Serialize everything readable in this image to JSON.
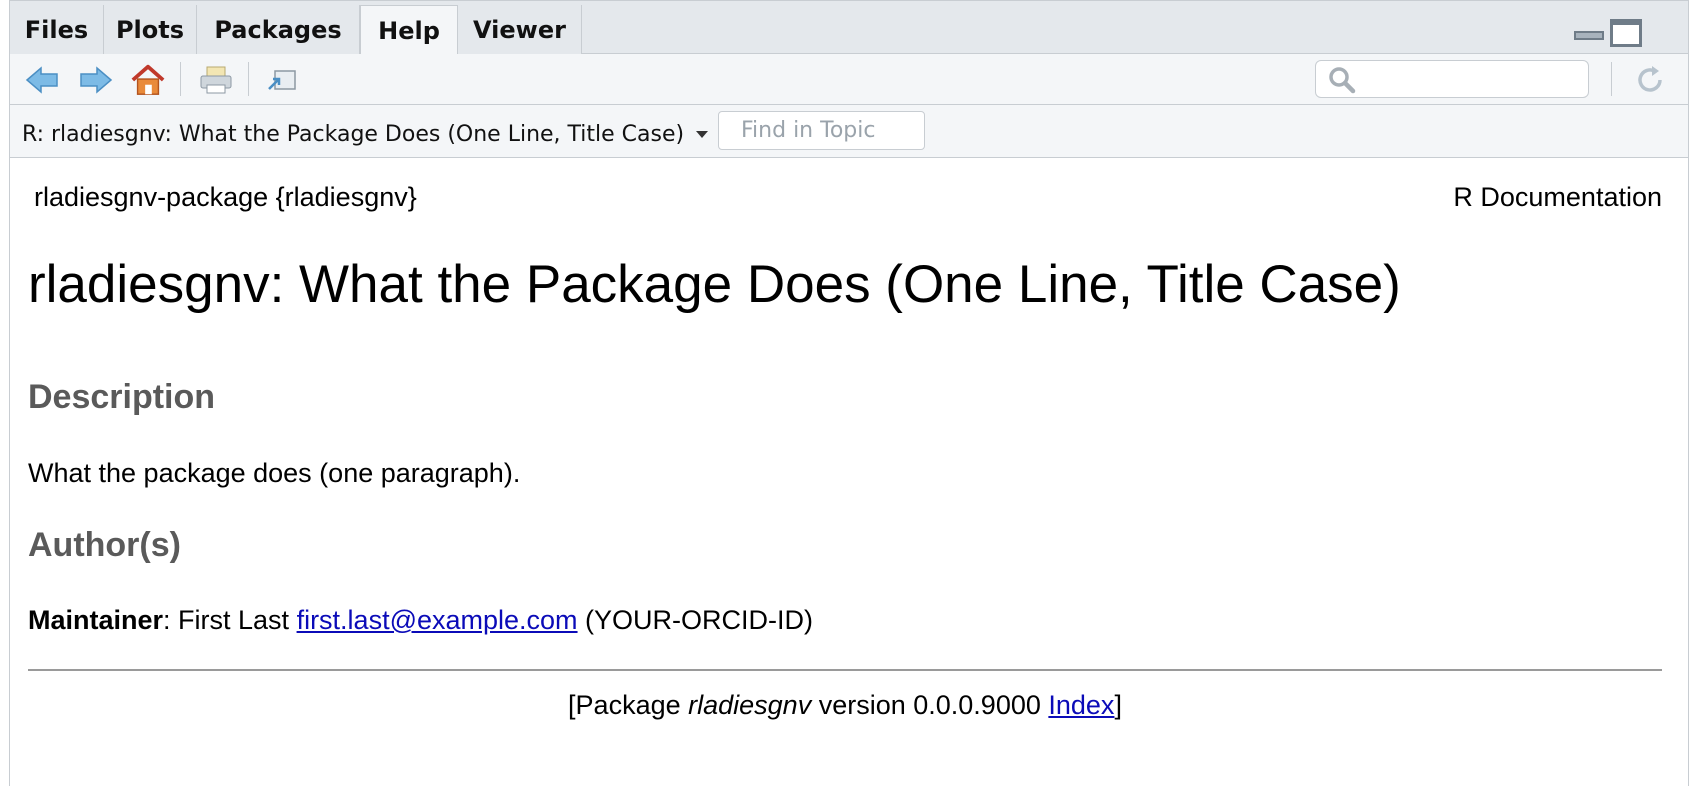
{
  "tabs": [
    {
      "label": "Files",
      "active": false
    },
    {
      "label": "Plots",
      "active": false
    },
    {
      "label": "Packages",
      "active": false
    },
    {
      "label": "Help",
      "active": true
    },
    {
      "label": "Viewer",
      "active": false
    }
  ],
  "toolbar": {
    "icons": [
      "back-arrow-icon",
      "forward-arrow-icon",
      "home-icon",
      "print-icon",
      "popout-window-icon",
      "search-icon",
      "refresh-icon"
    ],
    "search": {
      "value": "",
      "placeholder": ""
    }
  },
  "topic": {
    "selected": "R: rladiesgnv: What the Package Does (One Line, Title Case)",
    "find_placeholder": "Find in Topic"
  },
  "doc": {
    "name": "rladiesgnv-package {rladiesgnv}",
    "rdoc": "R Documentation",
    "title": "rladiesgnv: What the Package Does (One Line, Title Case)",
    "description_heading": "Description",
    "description_text": "What the package does (one paragraph).",
    "authors_heading": "Author(s)",
    "maintainer_label": "Maintainer",
    "maintainer_sep": ": First Last ",
    "maintainer_email": "first.last@example.com",
    "maintainer_orcid": " (YOUR-ORCID-ID)",
    "footer_prefix": "[Package ",
    "footer_pkg": "rladiesgnv",
    "footer_version": " version 0.0.0.9000 ",
    "footer_index": "Index",
    "footer_suffix": "]"
  },
  "colors": {
    "link": "#0b0bb8",
    "heading": "#5a5a5a",
    "chrome": "#e4e8ec",
    "toolbar": "#f4f6f8",
    "icon_blue": "#5aa6dc",
    "home_red": "#c0392b"
  }
}
